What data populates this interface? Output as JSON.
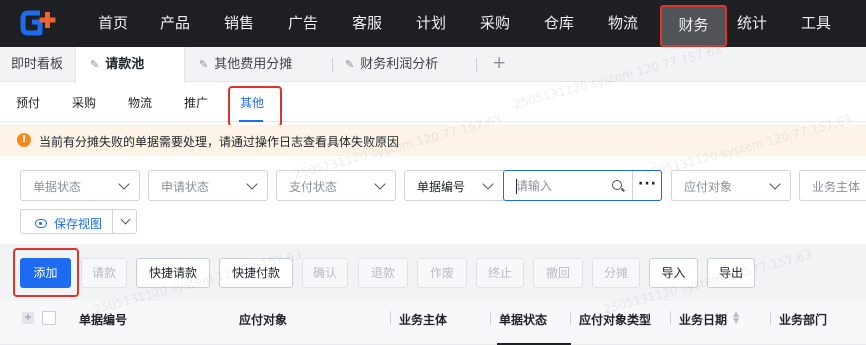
{
  "nav": {
    "logo": "G+",
    "items": [
      "首页",
      "产品",
      "销售",
      "广告",
      "客服",
      "计划",
      "采购",
      "仓库",
      "物流",
      "财务",
      "统计",
      "工具"
    ],
    "active": "财务"
  },
  "tabs": {
    "items": [
      "即时看板",
      "请款池",
      "其他费用分摊",
      "财务利润分析"
    ],
    "active": "请款池",
    "add_label": "+"
  },
  "subtabs": {
    "items": [
      "预付",
      "采购",
      "物流",
      "推广",
      "其他"
    ],
    "active": "其他"
  },
  "alert": {
    "icon": "warning-icon",
    "text": "当前有分摊失败的单据需要处理，请通过操作日志查看具体失败原因"
  },
  "filters": {
    "doc_status": "单据状态",
    "apply_status": "申请状态",
    "pay_status": "支付状态",
    "field_select": "单据编号",
    "search_placeholder": "请输入",
    "payee": "应付对象",
    "entity": "业务主体",
    "more_label": "···",
    "save_view": "保存视图"
  },
  "toolbar": {
    "buttons": [
      {
        "label": "添加",
        "state": "primary"
      },
      {
        "label": "请款",
        "state": "disabled"
      },
      {
        "label": "快捷请款",
        "state": "enabled"
      },
      {
        "label": "快捷付款",
        "state": "enabled"
      },
      {
        "label": "确认",
        "state": "disabled"
      },
      {
        "label": "退款",
        "state": "disabled"
      },
      {
        "label": "作废",
        "state": "disabled"
      },
      {
        "label": "终止",
        "state": "disabled"
      },
      {
        "label": "撤回",
        "state": "disabled"
      },
      {
        "label": "分摊",
        "state": "disabled"
      },
      {
        "label": "导入",
        "state": "enabled"
      },
      {
        "label": "导出",
        "state": "enabled"
      }
    ]
  },
  "table": {
    "columns": [
      "单据编号",
      "应付对象",
      "业务主体",
      "单据状态",
      "应付对象类型",
      "业务日期",
      "业务部门"
    ]
  },
  "watermark": "2505131120 system 120.77.157.63",
  "colors": {
    "nav_bg": "#1d1f23",
    "accent": "#1d6bf0",
    "highlight": "#e0342a",
    "logo_blue": "#1d6bf0",
    "logo_orange": "#f2622e",
    "alert_bg": "#fdf3e6"
  }
}
